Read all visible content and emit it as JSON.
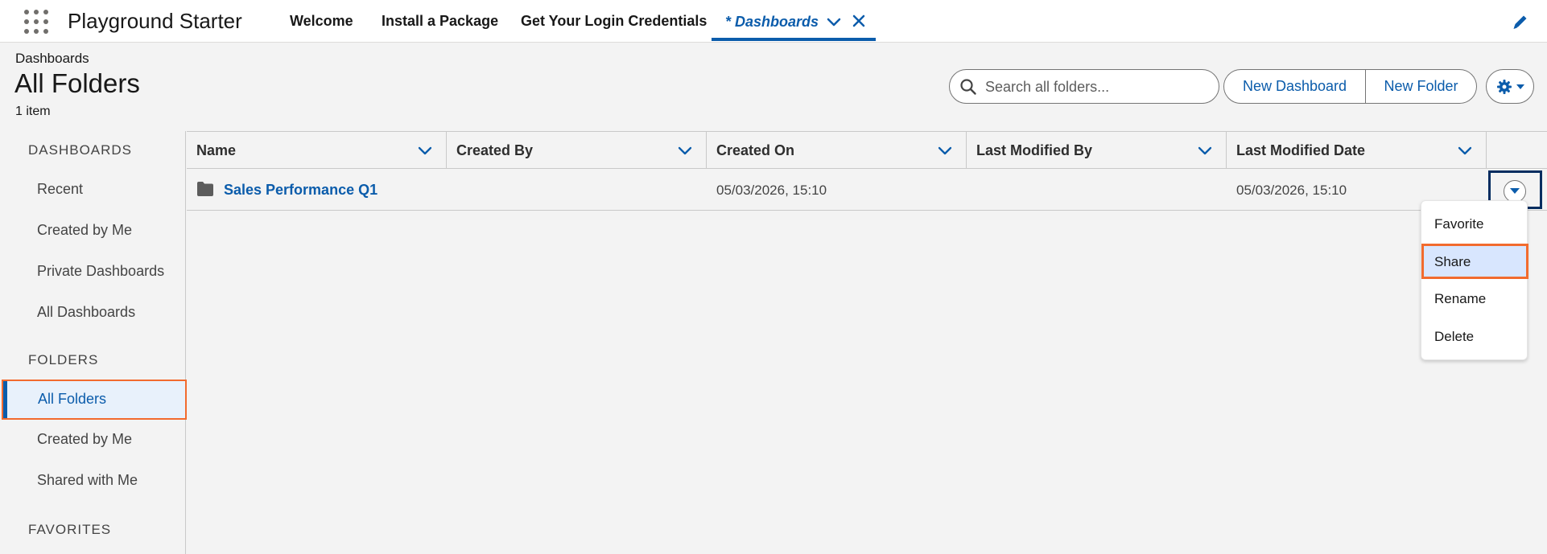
{
  "app": {
    "name": "Playground Starter"
  },
  "nav": {
    "items": [
      "Welcome",
      "Install a Package",
      "Get Your Login Credentials"
    ],
    "active_tab": "* Dashboards"
  },
  "header": {
    "breadcrumb": "Dashboards",
    "title": "All Folders",
    "item_count": "1 item"
  },
  "search": {
    "placeholder": "Search all folders..."
  },
  "buttons": {
    "new_dashboard": "New Dashboard",
    "new_folder": "New Folder"
  },
  "sidebar": {
    "sections": [
      "DASHBOARDS",
      "FOLDERS",
      "FAVORITES"
    ],
    "dashboards_items": [
      "Recent",
      "Created by Me",
      "Private Dashboards",
      "All Dashboards"
    ],
    "folders_items": [
      "All Folders",
      "Created by Me",
      "Shared with Me"
    ]
  },
  "table": {
    "columns": [
      "Name",
      "Created By",
      "Created On",
      "Last Modified By",
      "Last Modified Date"
    ],
    "rows": [
      {
        "name": "Sales Performance Q1",
        "created_by": "",
        "created_on": "05/03/2026, 15:10",
        "last_modified_by": "",
        "last_modified_date": "05/03/2026, 15:10"
      }
    ]
  },
  "row_menu": {
    "items": [
      "Favorite",
      "Share",
      "Rename",
      "Delete"
    ],
    "highlighted": "Share"
  },
  "colors": {
    "brand": "#0b5cab",
    "highlight_border": "#f26b2e",
    "background": "#f3f3f3"
  }
}
